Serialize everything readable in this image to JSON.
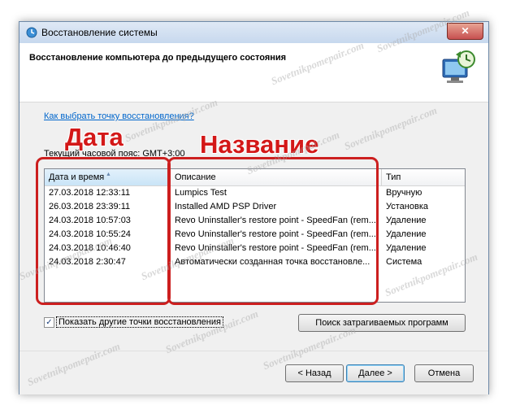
{
  "window": {
    "title": "Восстановление системы",
    "close_label": "✕",
    "heading": "Восстановление компьютера до предыдущего состояния"
  },
  "link_text": "Как выбрать точку восстановления?",
  "timezone": "Текущий часовой пояс: GMT+3:00",
  "table": {
    "headers": [
      "Дата и время",
      "Описание",
      "Тип"
    ],
    "rows": [
      [
        "27.03.2018 12:33:11",
        "Lumpics Test",
        "Вручную"
      ],
      [
        "26.03.2018 23:39:11",
        "Installed AMD PSP Driver",
        "Установка"
      ],
      [
        "24.03.2018 10:57:03",
        "Revo Uninstaller's restore point - SpeedFan (rem...",
        "Удаление"
      ],
      [
        "24.03.2018 10:55:24",
        "Revo Uninstaller's restore point - SpeedFan (rem...",
        "Удаление"
      ],
      [
        "24.03.2018 10:46:40",
        "Revo Uninstaller's restore point - SpeedFan (rem...",
        "Удаление"
      ],
      [
        "24.03.2018 2:30:47",
        "Автоматически созданная точка восстановле...",
        "Система"
      ]
    ]
  },
  "show_more": {
    "label": "Показать другие точки восстановления",
    "checked": true,
    "check_glyph": "✓"
  },
  "buttons": {
    "scan": "Поиск затрагиваемых программ",
    "back": "< Назад",
    "next": "Далее >",
    "cancel": "Отмена"
  },
  "annotations": {
    "date": "Дата",
    "name": "Название"
  },
  "watermark": "Sovetnikpomepair.com",
  "colors": {
    "annotation": "#cc1f1f",
    "link": "#0066cc",
    "titlebar": "#c7d8ee"
  },
  "icons": [
    "system-restore-icon",
    "close-icon",
    "restore-computer-icon",
    "sort-arrow-icon",
    "checkmark-icon"
  ]
}
